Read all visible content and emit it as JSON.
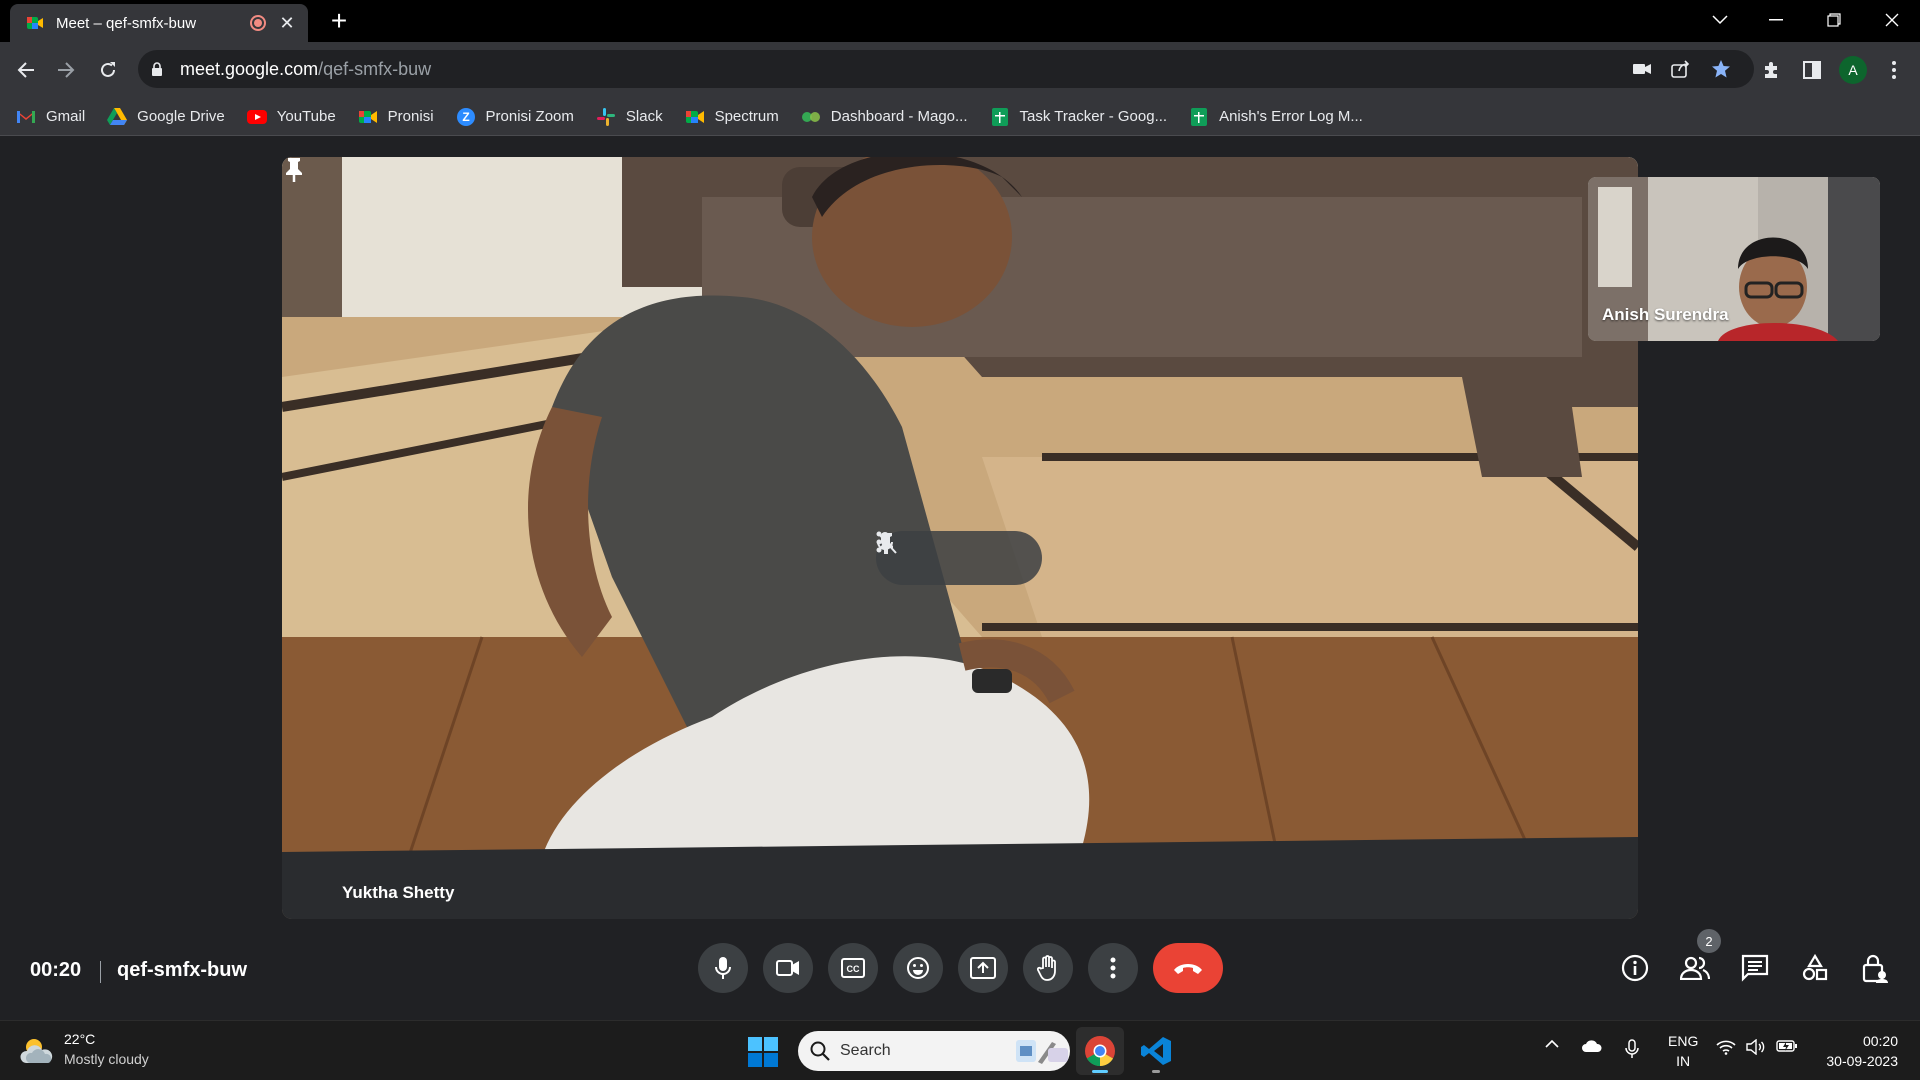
{
  "browser": {
    "tab_title": "Meet – qef-smfx-buw",
    "url_host": "meet.google.com",
    "url_path": "/qef-smfx-buw",
    "profile_initial": "A",
    "bookmarks": [
      {
        "label": "Gmail",
        "icon": "gmail-icon"
      },
      {
        "label": "Google Drive",
        "icon": "drive-icon"
      },
      {
        "label": "YouTube",
        "icon": "youtube-icon"
      },
      {
        "label": "Pronisi",
        "icon": "meet-icon"
      },
      {
        "label": "Pronisi Zoom",
        "icon": "zoom-icon"
      },
      {
        "label": "Slack",
        "icon": "slack-icon"
      },
      {
        "label": "Spectrum",
        "icon": "meet-icon"
      },
      {
        "label": "Dashboard - Mago...",
        "icon": "mago-icon"
      },
      {
        "label": "Task Tracker - Goog...",
        "icon": "sheets-icon"
      },
      {
        "label": "Anish's Error Log M...",
        "icon": "sheets-icon"
      }
    ]
  },
  "meet": {
    "main_participant": "Yuktha Shetty",
    "self_participant": "Anish Surendra",
    "elapsed": "00:20",
    "meeting_code": "qef-smfx-buw",
    "participant_count": "2",
    "colors": {
      "end_call": "#ea4335",
      "control_bg": "#3c4043",
      "background": "#202124"
    }
  },
  "taskbar": {
    "temperature": "22°C",
    "weather": "Mostly cloudy",
    "search_label": "Search",
    "lang_top": "ENG",
    "lang_bottom": "IN",
    "time": "00:20",
    "date": "30-09-2023"
  }
}
